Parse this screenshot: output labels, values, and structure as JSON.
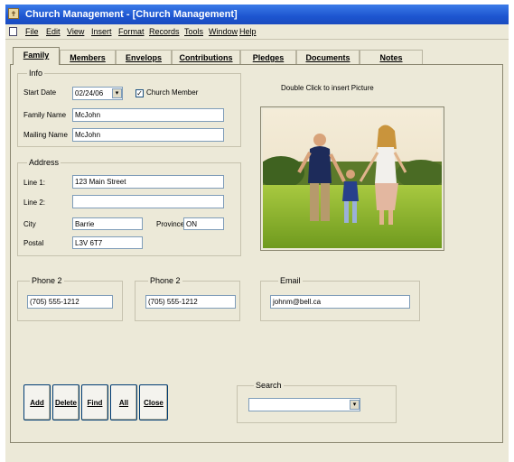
{
  "window": {
    "title": "Church Management - [Church Management]"
  },
  "menu": [
    "File",
    "Edit",
    "View",
    "Insert",
    "Format",
    "Records",
    "Tools",
    "Window",
    "Help"
  ],
  "tabs": [
    "Family",
    "Members",
    "Envelops",
    "Contributions",
    "Pledges",
    "Documents",
    "Notes"
  ],
  "info": {
    "legend": "Info",
    "start_date_label": "Start Date",
    "start_date": "02/24/06",
    "church_member_label": "Church Member",
    "church_member_checked": "✓",
    "family_name_label": "Family Name",
    "family_name": "McJohn",
    "mailing_name_label": "Mailing Name",
    "mailing_name": "McJohn"
  },
  "address": {
    "legend": "Address",
    "line1_label": "Line 1:",
    "line1": "123 Main Street",
    "line2_label": "Line 2:",
    "line2": "",
    "city_label": "City",
    "city": "Barrie",
    "province_label": "Province",
    "province": "ON",
    "postal_label": "Postal",
    "postal": "L3V 6T7"
  },
  "photo": {
    "hint": "Double Click to insert Picture"
  },
  "contact": {
    "phone1_legend": "Phone 2",
    "phone1": "(705) 555-1212",
    "phone2_legend": "Phone 2",
    "phone2": "(705) 555-1212",
    "email_legend": "Email",
    "email": "johnm@bell.ca"
  },
  "buttons": {
    "add": "Add",
    "delete": "Delete",
    "find": "Find",
    "all": "All",
    "close": "Close"
  },
  "search": {
    "legend": "Search",
    "value": ""
  },
  "icons": {
    "app": "church-app-icon",
    "dropdown": "chevron-down-icon"
  },
  "colors": {
    "titlebar": "#1d55d0",
    "face": "#ece9d8",
    "field_border": "#7f9db9"
  }
}
